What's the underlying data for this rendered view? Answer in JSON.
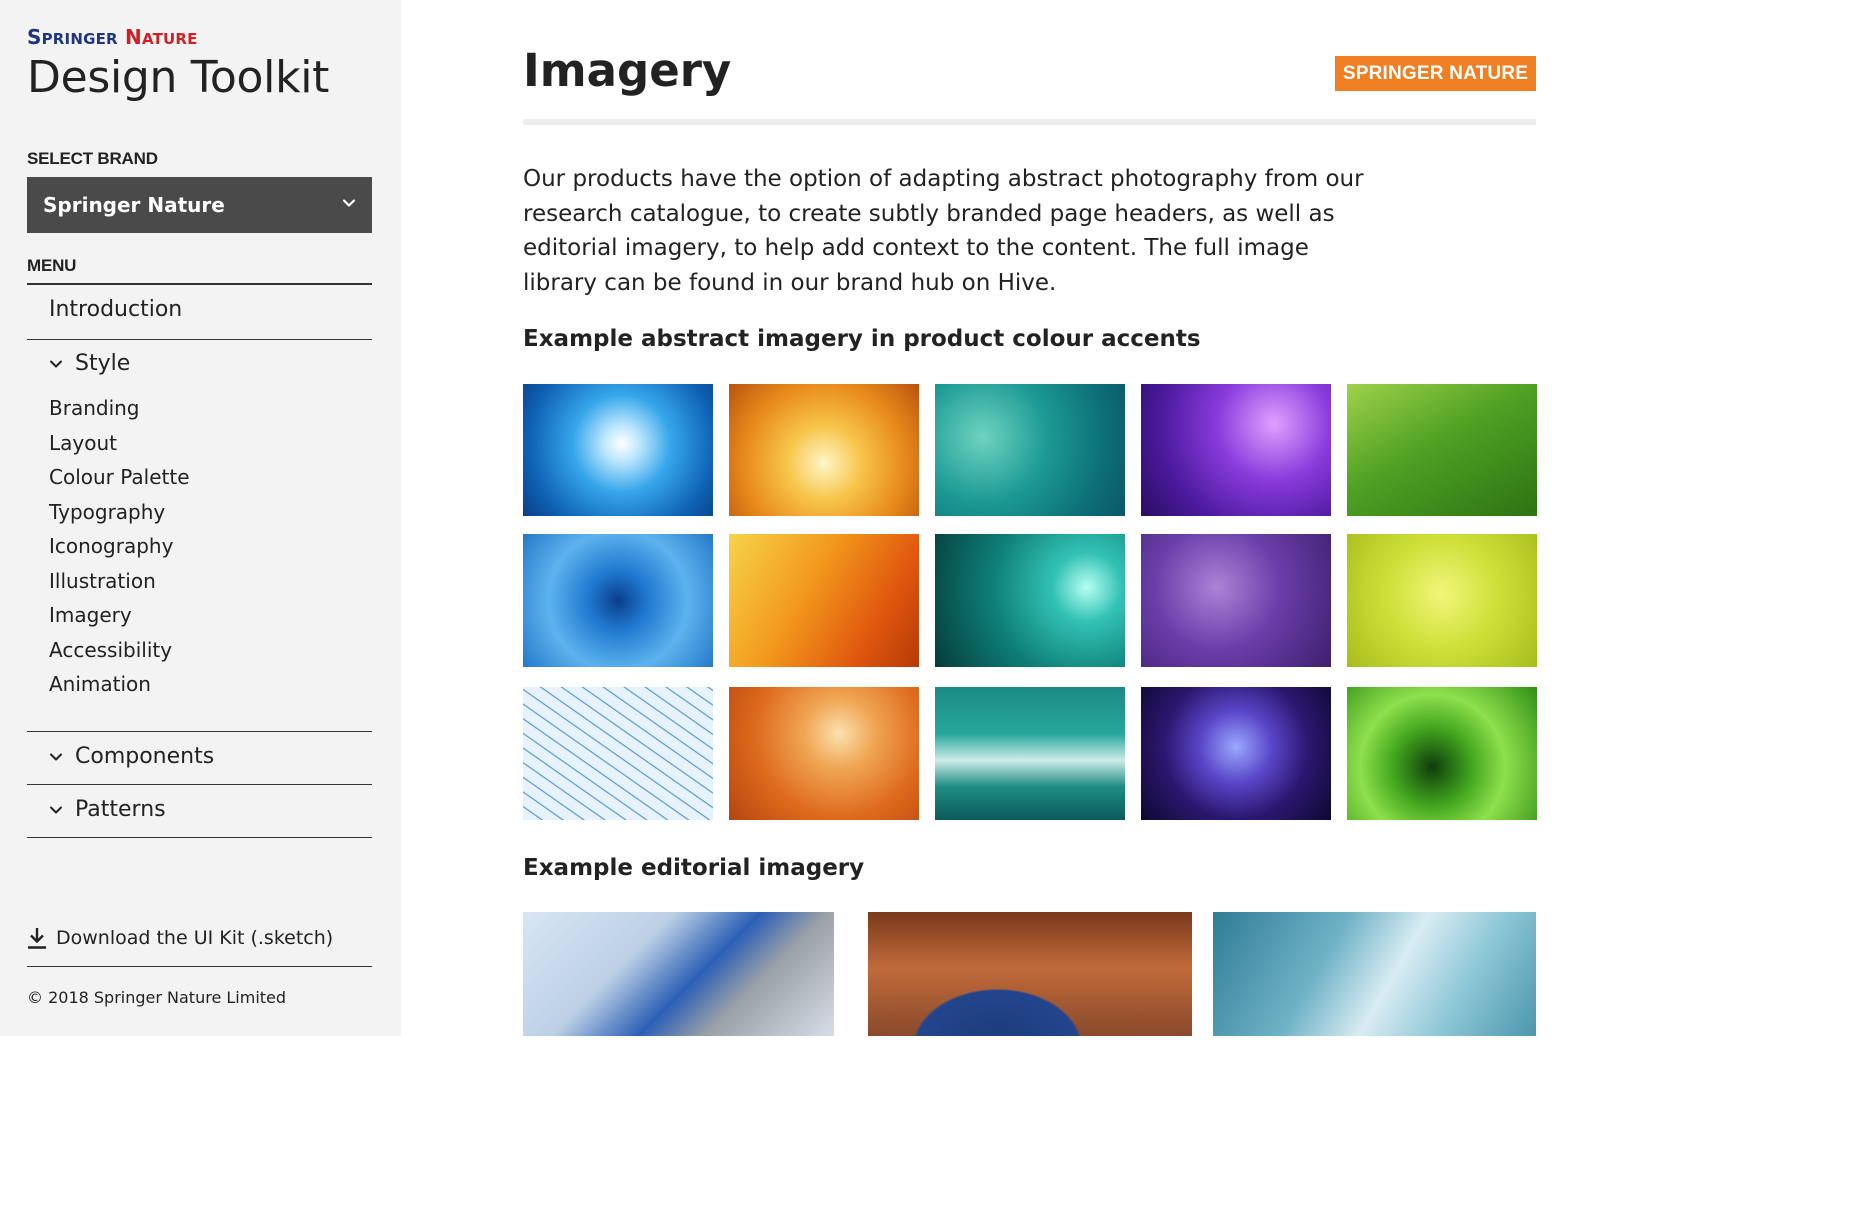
{
  "sidebar": {
    "logo": {
      "word1_first": "S",
      "word1_rest": "PRINGER",
      "word2_first": "N",
      "word2_rest": "ATURE"
    },
    "site_title": "Design Toolkit",
    "select_brand_label": "SELECT BRAND",
    "brand_select_value": "Springer Nature",
    "menu_label": "MENU",
    "menu": {
      "introduction": "Introduction",
      "style": {
        "label": "Style",
        "items": [
          "Branding",
          "Layout",
          "Colour Palette",
          "Typography",
          "Iconography",
          "Illustration",
          "Imagery",
          "Accessibility",
          "Animation"
        ]
      },
      "components": "Components",
      "patterns": "Patterns"
    },
    "download_label": "Download the UI Kit (.sketch)",
    "copyright": "© 2018 Springer Nature Limited"
  },
  "main": {
    "title": "Imagery",
    "brand_badge": "SPRINGER NATURE",
    "intro": "Our products have the option of adapting abstract photography from our research catalogue, to create subtly branded page headers, as well as editorial imagery, to help add context to the content. The full image library can be found in our brand hub on Hive.",
    "abstract_heading": "Example abstract imagery in product colour accents",
    "editorial_heading": "Example editorial imagery"
  },
  "colors": {
    "sidebar_bg": "#f3f3f3",
    "select_bg": "#4a4a4a",
    "badge": "#f07e22",
    "logo_blue": "#1f3580",
    "logo_red": "#cf2027"
  },
  "icons": {
    "select_chevron": "chevron-down-icon",
    "section_chevron": "chevron-down-icon",
    "download": "download-icon"
  }
}
